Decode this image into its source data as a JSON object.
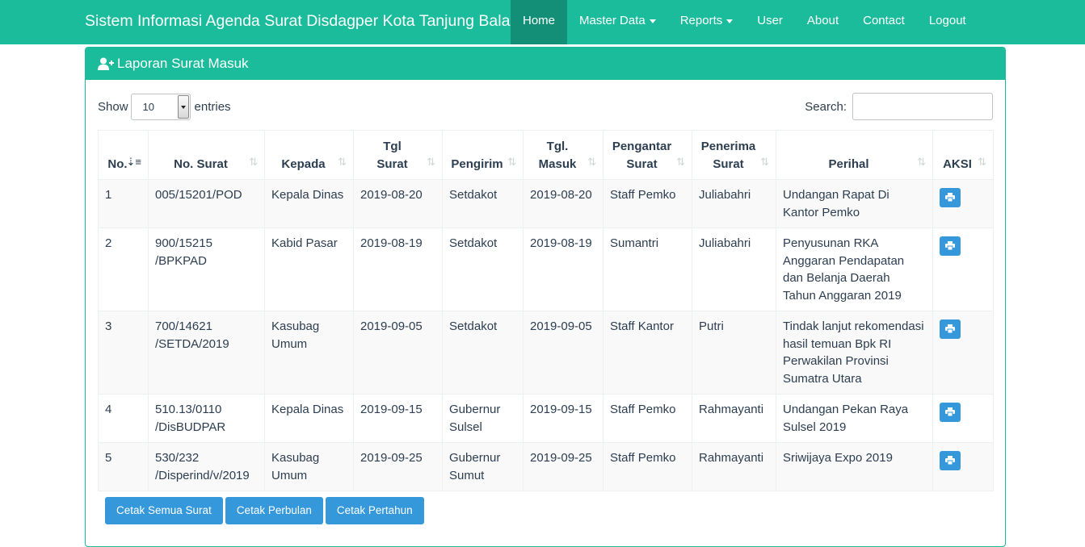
{
  "navbar": {
    "brand": "Sistem Informasi Agenda Surat Disdagper Kota Tanjung Balai",
    "items": [
      {
        "label": "Home",
        "active": true,
        "dropdown": false
      },
      {
        "label": "Master Data",
        "active": false,
        "dropdown": true
      },
      {
        "label": "Reports",
        "active": false,
        "dropdown": true
      },
      {
        "label": "User",
        "active": false,
        "dropdown": false
      },
      {
        "label": "About",
        "active": false,
        "dropdown": false
      },
      {
        "label": "Contact",
        "active": false,
        "dropdown": false
      },
      {
        "label": "Logout",
        "active": false,
        "dropdown": false
      }
    ]
  },
  "panel": {
    "title": "Laporan Surat Masuk",
    "icon": "user-plus-icon"
  },
  "length_control": {
    "show_label": "Show",
    "value": "10",
    "entries_label": "entries"
  },
  "search": {
    "label": "Search:",
    "value": ""
  },
  "table": {
    "columns": [
      {
        "line1": "",
        "line2": "No.",
        "sorted": true
      },
      {
        "line1": "",
        "line2": "No. Surat",
        "sorted": false
      },
      {
        "line1": "",
        "line2": "Kepada",
        "sorted": false
      },
      {
        "line1": "Tgl",
        "line2": "Surat",
        "sorted": false,
        "center": true
      },
      {
        "line1": "",
        "line2": "Pengirim",
        "sorted": false
      },
      {
        "line1": "Tgl.",
        "line2": "Masuk",
        "sorted": false
      },
      {
        "line1": "Pengantar",
        "line2": "Surat",
        "sorted": false
      },
      {
        "line1": "Penerima",
        "line2": "Surat",
        "sorted": false
      },
      {
        "line1": "",
        "line2": "Perihal",
        "sorted": false,
        "center": true
      },
      {
        "line1": "",
        "line2": "AKSI",
        "sorted": false
      }
    ],
    "rows": [
      {
        "no": "1",
        "no_surat": "005/15201/POD",
        "kepada": "Kepala Dinas",
        "tgl_surat": "2019-08-20",
        "pengirim": "Setdakot",
        "tgl_masuk": "2019-08-20",
        "pengantar": "Staff Pemko",
        "penerima": "Juliabahri",
        "perihal": "Undangan Rapat Di Kantor Pemko"
      },
      {
        "no": "2",
        "no_surat": "900/15215 /BPKPAD",
        "kepada": "Kabid Pasar",
        "tgl_surat": "2019-08-19",
        "pengirim": "Setdakot",
        "tgl_masuk": "2019-08-19",
        "pengantar": "Sumantri",
        "penerima": "Juliabahri",
        "perihal": "Penyusunan RKA Anggaran Pendapatan dan Belanja Daerah Tahun Anggaran 2019"
      },
      {
        "no": "3",
        "no_surat": "700/14621 /SETDA/2019",
        "kepada": "Kasubag Umum",
        "tgl_surat": "2019-09-05",
        "pengirim": "Setdakot",
        "tgl_masuk": "2019-09-05",
        "pengantar": "Staff Kantor",
        "penerima": "Putri",
        "perihal": "Tindak lanjut rekomendasi hasil temuan Bpk RI Perwakilan Provinsi Sumatra Utara"
      },
      {
        "no": "4",
        "no_surat": "510.13/0110 /DisBUDPAR",
        "kepada": "Kepala Dinas",
        "tgl_surat": "2019-09-15",
        "pengirim": "Gubernur Sulsel",
        "tgl_masuk": "2019-09-15",
        "pengantar": "Staff Pemko",
        "penerima": "Rahmayanti",
        "perihal": "Undangan Pekan Raya Sulsel 2019"
      },
      {
        "no": "5",
        "no_surat": "530/232 /Disperind/v/2019",
        "kepada": "Kasubag Umum",
        "tgl_surat": "2019-09-25",
        "pengirim": "Gubernur Sumut",
        "tgl_masuk": "2019-09-25",
        "pengantar": "Staff Pemko",
        "penerima": "Rahmayanti",
        "perihal": "Sriwijaya Expo 2019"
      }
    ]
  },
  "buttons": {
    "print_all": "Cetak Semua Surat",
    "print_month": "Cetak Perbulan",
    "print_year": "Cetak Pertahun"
  },
  "colors": {
    "primary": "#1abc9c",
    "active_nav": "#128f76",
    "button": "#3498db"
  }
}
